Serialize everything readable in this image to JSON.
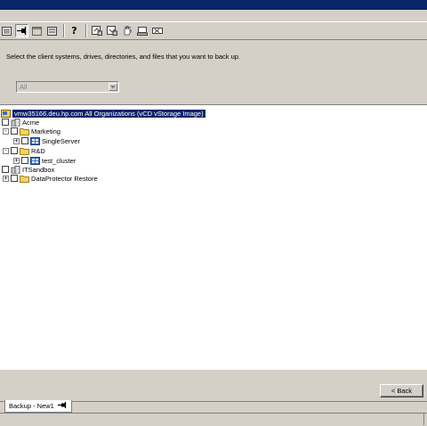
{
  "toolbar": {
    "buttons": [
      {
        "name": "list-view-icon",
        "pressed": false
      },
      {
        "name": "pin-icon",
        "pressed": true
      },
      {
        "name": "window-icon",
        "pressed": false
      },
      {
        "name": "properties-icon",
        "pressed": false
      },
      {
        "name": "help-icon",
        "pressed": false,
        "glyph": "?"
      },
      {
        "name": "backup-object-icon",
        "pressed": false
      },
      {
        "name": "restore-object-icon",
        "pressed": false
      },
      {
        "name": "hand-icon",
        "pressed": false
      },
      {
        "name": "monitor-icon",
        "pressed": false
      },
      {
        "name": "cancel-icon",
        "pressed": false
      }
    ]
  },
  "page": {
    "instruction": "Select the client systems, drives, directories, and files that you want to back up."
  },
  "filter": {
    "selected": "All"
  },
  "tree": {
    "root": "vmw35166.deu.hp.com All Organizations (vCD vStorage Image)",
    "items": [
      {
        "label": "Acme",
        "type": "org"
      },
      {
        "label": "Marketing",
        "type": "folder"
      },
      {
        "label": "SingleServer",
        "type": "vapp"
      },
      {
        "label": "R&D",
        "type": "folder"
      },
      {
        "label": "test_cluster",
        "type": "vapp"
      },
      {
        "label": "ITSandbox",
        "type": "org"
      },
      {
        "label": "DataProtector Restore",
        "type": "folder"
      }
    ]
  },
  "nav": {
    "back_label": "< Back"
  },
  "tabs": {
    "active_label": "Backup - New1"
  },
  "colors": {
    "titlebar": "#0a246a",
    "selection": "#0a246a",
    "panel": "#d4d0c8",
    "folder": "#f4d35e"
  }
}
